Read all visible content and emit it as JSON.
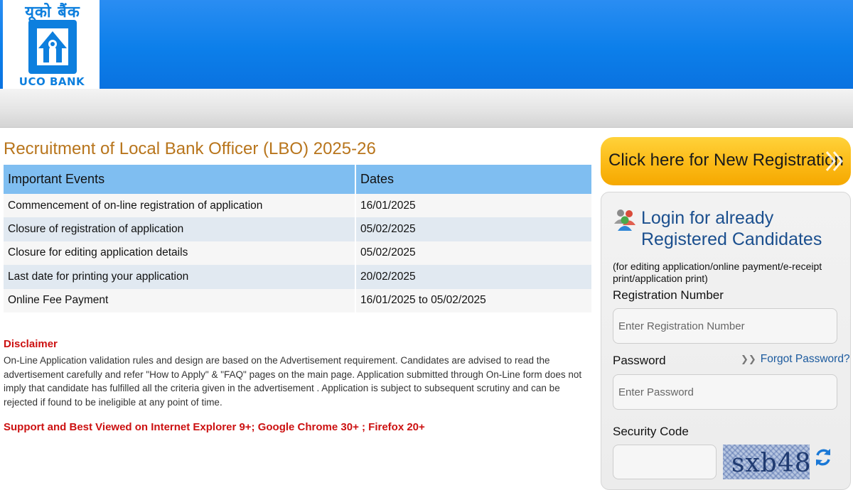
{
  "header": {
    "logo_hindi": "यूको बैंक",
    "logo_text": "UCO BANK"
  },
  "main": {
    "title": "Recruitment of Local Bank Officer (LBO) 2025-26",
    "table": {
      "headers": [
        "Important Events",
        "Dates"
      ],
      "rows": [
        [
          "Commencement of on-line registration of application",
          "16/01/2025"
        ],
        [
          "Closure of registration of application",
          "05/02/2025"
        ],
        [
          "Closure for editing application details",
          "05/02/2025"
        ],
        [
          "Last date for printing your application",
          "20/02/2025"
        ],
        [
          "Online Fee Payment",
          "16/01/2025 to 05/02/2025"
        ]
      ]
    },
    "disclaimer_title": "Disclaimer",
    "disclaimer_text": "On-Line Application validation rules and design are based on the Advertisement requirement. Candidates are advised to read the advertisement carefully and refer \"How to Apply\" & \"FAQ\" pages on the main page. Application submitted through On-Line form does not imply that candidate has fulfilled all the criteria given in the advertisement . Application is subject to subsequent scrutiny and can be rejected if found to be ineligible at any point of time.",
    "support_text": "Support and Best Viewed on Internet Explorer 9+; Google Chrome 30+ ; Firefox 20+"
  },
  "sidebar": {
    "new_registration_label": "Click here for New Registration",
    "login_title": "Login for already Registered Candidates",
    "login_note": "(for editing application/online payment/e-receipt print/application print)",
    "registration_label": "Registration Number",
    "registration_placeholder": "Enter Registration Number",
    "password_label": "Password",
    "password_placeholder": "Enter Password",
    "forgot_password": "Forgot Password?",
    "security_code_label": "Security Code",
    "captcha_text": "sxb48"
  },
  "colors": {
    "header_blue": "#0c7fea",
    "title_orange": "#b8751c",
    "table_header": "#7fbef1",
    "alert_red": "#cc1111",
    "button_yellow": "#fbb814",
    "link_blue": "#1b5a9e"
  },
  "icons": [
    "uco-bank-logo",
    "users-icon",
    "chevron-right-icon",
    "double-chevron-icon",
    "refresh-icon"
  ]
}
